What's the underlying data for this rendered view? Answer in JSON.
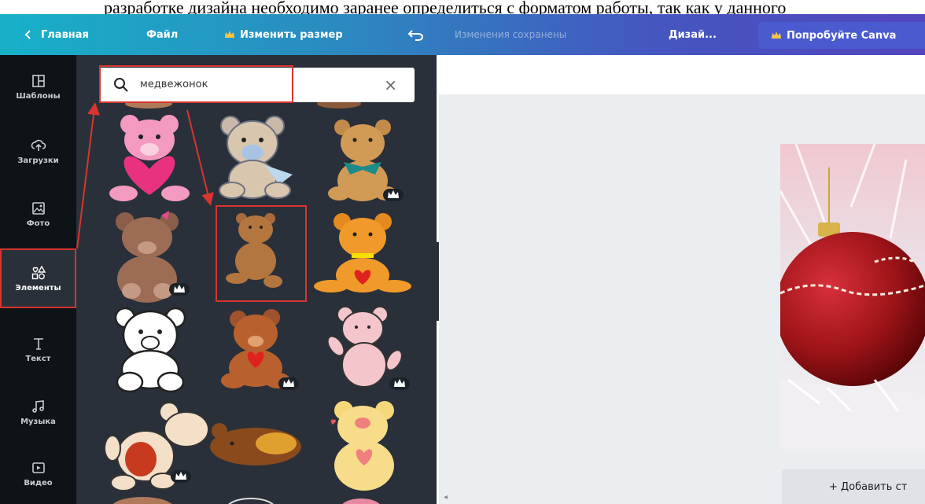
{
  "caption": {
    "text": "разработке дизайна необходимо заранее определиться с форматом работы, так как у данного"
  },
  "topbar": {
    "home_label": "Главная",
    "file_label": "Файл",
    "resize_label": "Изменить размер",
    "saved_status": "Изменения сохранены",
    "design_label": "Дизай...",
    "try_label": "Попробуйте Canva"
  },
  "leftnav": {
    "items": [
      {
        "label": "Шаблоны",
        "icon": "templates-icon"
      },
      {
        "label": "Загрузки",
        "icon": "upload-cloud-icon"
      },
      {
        "label": "Фото",
        "icon": "photo-icon"
      },
      {
        "label": "Элементы",
        "icon": "elements-icon"
      },
      {
        "label": "Текст",
        "icon": "text-icon"
      },
      {
        "label": "Музыка",
        "icon": "music-icon"
      },
      {
        "label": "Видео",
        "icon": "video-icon"
      }
    ]
  },
  "search": {
    "value": "медвежонок",
    "icon": "search-icon"
  },
  "canvas": {
    "add_page_label": "+ Добавить ст"
  },
  "colors": {
    "accent_red": "#d9342f",
    "panel_dark": "#293039",
    "nav_dark": "#0e1318",
    "canvas_bg": "#eaeef1"
  }
}
